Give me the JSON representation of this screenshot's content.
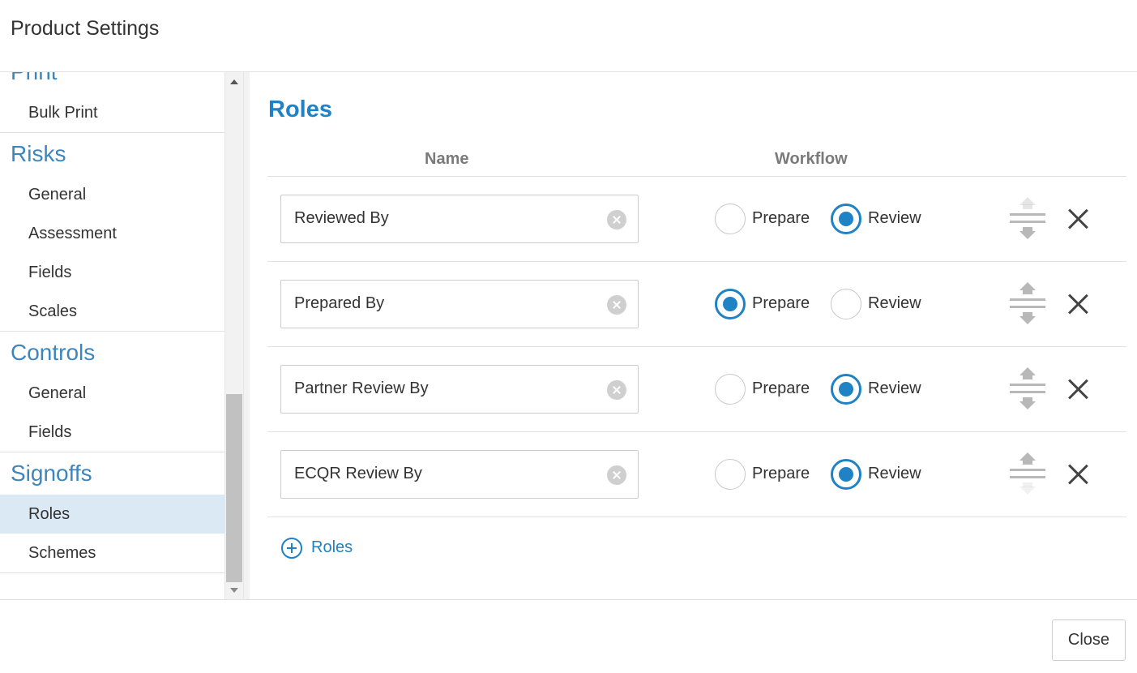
{
  "header": {
    "title": "Product Settings"
  },
  "sidebar": {
    "sections": [
      {
        "heading": "Print",
        "items": [
          {
            "label": "Bulk Print"
          }
        ]
      },
      {
        "heading": "Risks",
        "items": [
          {
            "label": "General"
          },
          {
            "label": "Assessment"
          },
          {
            "label": "Fields"
          },
          {
            "label": "Scales"
          }
        ]
      },
      {
        "heading": "Controls",
        "items": [
          {
            "label": "General"
          },
          {
            "label": "Fields"
          }
        ]
      },
      {
        "heading": "Signoffs",
        "items": [
          {
            "label": "Roles",
            "active": true
          },
          {
            "label": "Schemes"
          }
        ]
      }
    ]
  },
  "main": {
    "heading": "Roles",
    "columns": {
      "name": "Name",
      "workflow": "Workflow"
    },
    "roles": [
      {
        "name": "Reviewed By",
        "workflow": "review"
      },
      {
        "name": "Prepared By",
        "workflow": "prepare"
      },
      {
        "name": "Partner Review By",
        "workflow": "review"
      },
      {
        "name": "ECQR Review By",
        "workflow": "review"
      }
    ],
    "workflow_options": {
      "prepare": "Prepare",
      "review": "Review"
    },
    "add_label": "Roles"
  },
  "footer": {
    "close_label": "Close"
  },
  "colors": {
    "accent": "#1e82c4",
    "sidebar_heading": "#3d86bd",
    "active_bg": "#dbe9f5"
  },
  "icons": [
    "clear-icon",
    "move-up-down-icon",
    "close-icon",
    "add-circle-icon",
    "scroll-up-arrow-icon",
    "scroll-down-arrow-icon"
  ]
}
